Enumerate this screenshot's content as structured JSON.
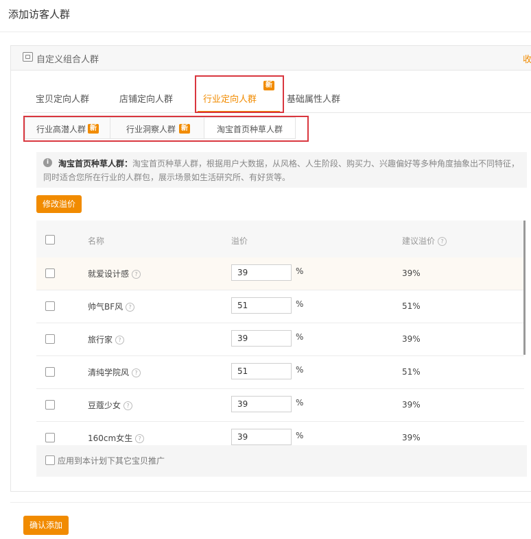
{
  "page": {
    "title": "添加访客人群"
  },
  "panel": {
    "title": "自定义组合人群",
    "collapse_label": "收"
  },
  "tabs": [
    {
      "label": "宝贝定向人群"
    },
    {
      "label": "店铺定向人群"
    },
    {
      "label": "行业定向人群",
      "badge": "新"
    },
    {
      "label": "基础属性人群"
    }
  ],
  "subtabs": [
    {
      "label": "行业高潜人群",
      "badge": "新"
    },
    {
      "label": "行业洞察人群",
      "badge": "新"
    },
    {
      "label": "淘宝首页种草人群"
    }
  ],
  "info": {
    "heading": "淘宝首页种草人群：",
    "text": "淘宝首页种草人群，根据用户大数据，从风格、人生阶段、购买力、兴趣偏好等多种角度抽象出不同特征，同时适合您所在行业的人群包，展示场景如生活研究所、有好货等。"
  },
  "modify_button": "修改溢价",
  "table": {
    "headers": {
      "name": "名称",
      "premium": "溢价",
      "suggested": "建议溢价"
    },
    "rows": [
      {
        "name": "就爱设计感",
        "premium": "39",
        "unit": "%",
        "suggested": "39%"
      },
      {
        "name": "帅气BF风",
        "premium": "51",
        "unit": "%",
        "suggested": "51%"
      },
      {
        "name": "旅行家",
        "premium": "39",
        "unit": "%",
        "suggested": "39%"
      },
      {
        "name": "清纯学院风",
        "premium": "51",
        "unit": "%",
        "suggested": "51%"
      },
      {
        "name": "豆蔻少女",
        "premium": "39",
        "unit": "%",
        "suggested": "39%"
      },
      {
        "name": "160cm女生",
        "premium": "39",
        "unit": "%",
        "suggested": "39%"
      }
    ]
  },
  "apply_label": "应用到本计划下其它宝贝推广",
  "confirm_button": "确认添加",
  "colors": {
    "accent": "#f18b00",
    "highlight_box": "#d9363e"
  }
}
